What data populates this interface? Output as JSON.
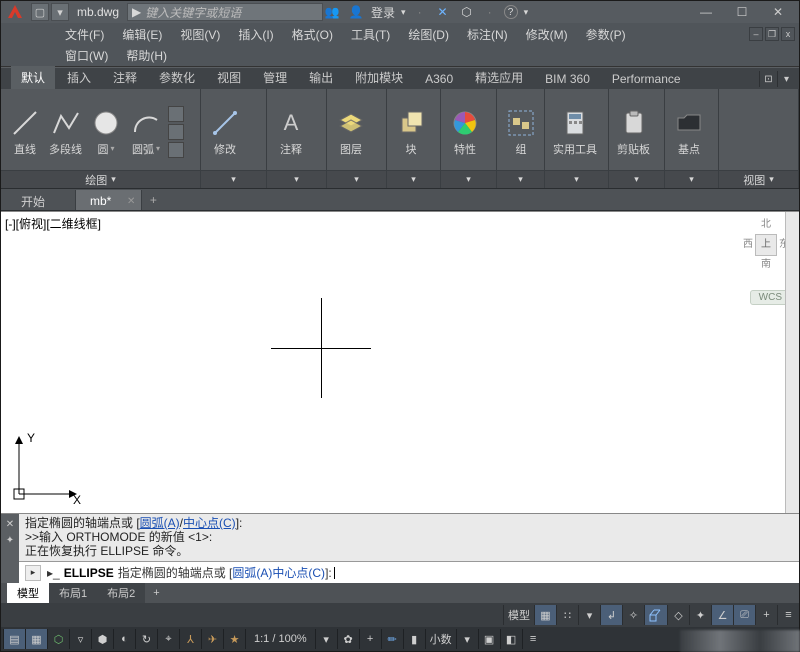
{
  "titlebar": {
    "filename": "mb.dwg",
    "search_placeholder": "键入关键字或短语",
    "login_label": "登录"
  },
  "menus": {
    "row1": [
      "文件(F)",
      "编辑(E)",
      "视图(V)",
      "插入(I)",
      "格式(O)",
      "工具(T)",
      "绘图(D)",
      "标注(N)",
      "修改(M)",
      "参数(P)"
    ],
    "row2": [
      "窗口(W)",
      "帮助(H)"
    ]
  },
  "ribbon": {
    "tabs": [
      "默认",
      "插入",
      "注释",
      "参数化",
      "视图",
      "管理",
      "输出",
      "附加模块",
      "A360",
      "精选应用",
      "BIM 360",
      "Performance"
    ],
    "active_tab": "默认",
    "draw_panel": {
      "title": "绘图",
      "tools": {
        "line": "直线",
        "polyline": "多段线",
        "circle": "圆",
        "arc": "圆弧"
      }
    },
    "panels": {
      "modify": "修改",
      "annotate": "注释",
      "layer": "图层",
      "block": "块",
      "properties": "特性",
      "group": "组",
      "util": "实用工具",
      "clipboard": "剪贴板",
      "base": "基点",
      "view": "视图"
    }
  },
  "file_tabs": {
    "start": "开始",
    "doc": "mb*"
  },
  "viewport": {
    "label": "[-][俯视][二维线框]",
    "navcube": {
      "north": "北",
      "west": "西",
      "top": "上",
      "east": "东",
      "south": "南"
    },
    "wcs": "WCS",
    "axis_x": "X",
    "axis_y": "Y"
  },
  "command": {
    "history_line1_pre": "指定椭圆的轴端点或 [",
    "history_line1_arc": "圆弧(A)",
    "history_line1_sep": "/",
    "history_line1_center": "中心点(C)",
    "history_line1_post": "]:",
    "history_line2": ">>输入 ORTHOMODE 的新值 <1>:",
    "history_line3": "正在恢复执行 ELLIPSE 命令。",
    "prompt_cmd": "ELLIPSE",
    "prompt_text": "指定椭圆的轴端点或 [",
    "prompt_arc": "圆弧(A)",
    "prompt_space": " ",
    "prompt_center": "中心点(C)",
    "prompt_end": "]:"
  },
  "layout": {
    "model": "模型",
    "layout1": "布局1",
    "layout2": "布局2"
  },
  "status": {
    "space_label": "模型",
    "zoom": "1:1 / 100%",
    "units": "小数"
  }
}
